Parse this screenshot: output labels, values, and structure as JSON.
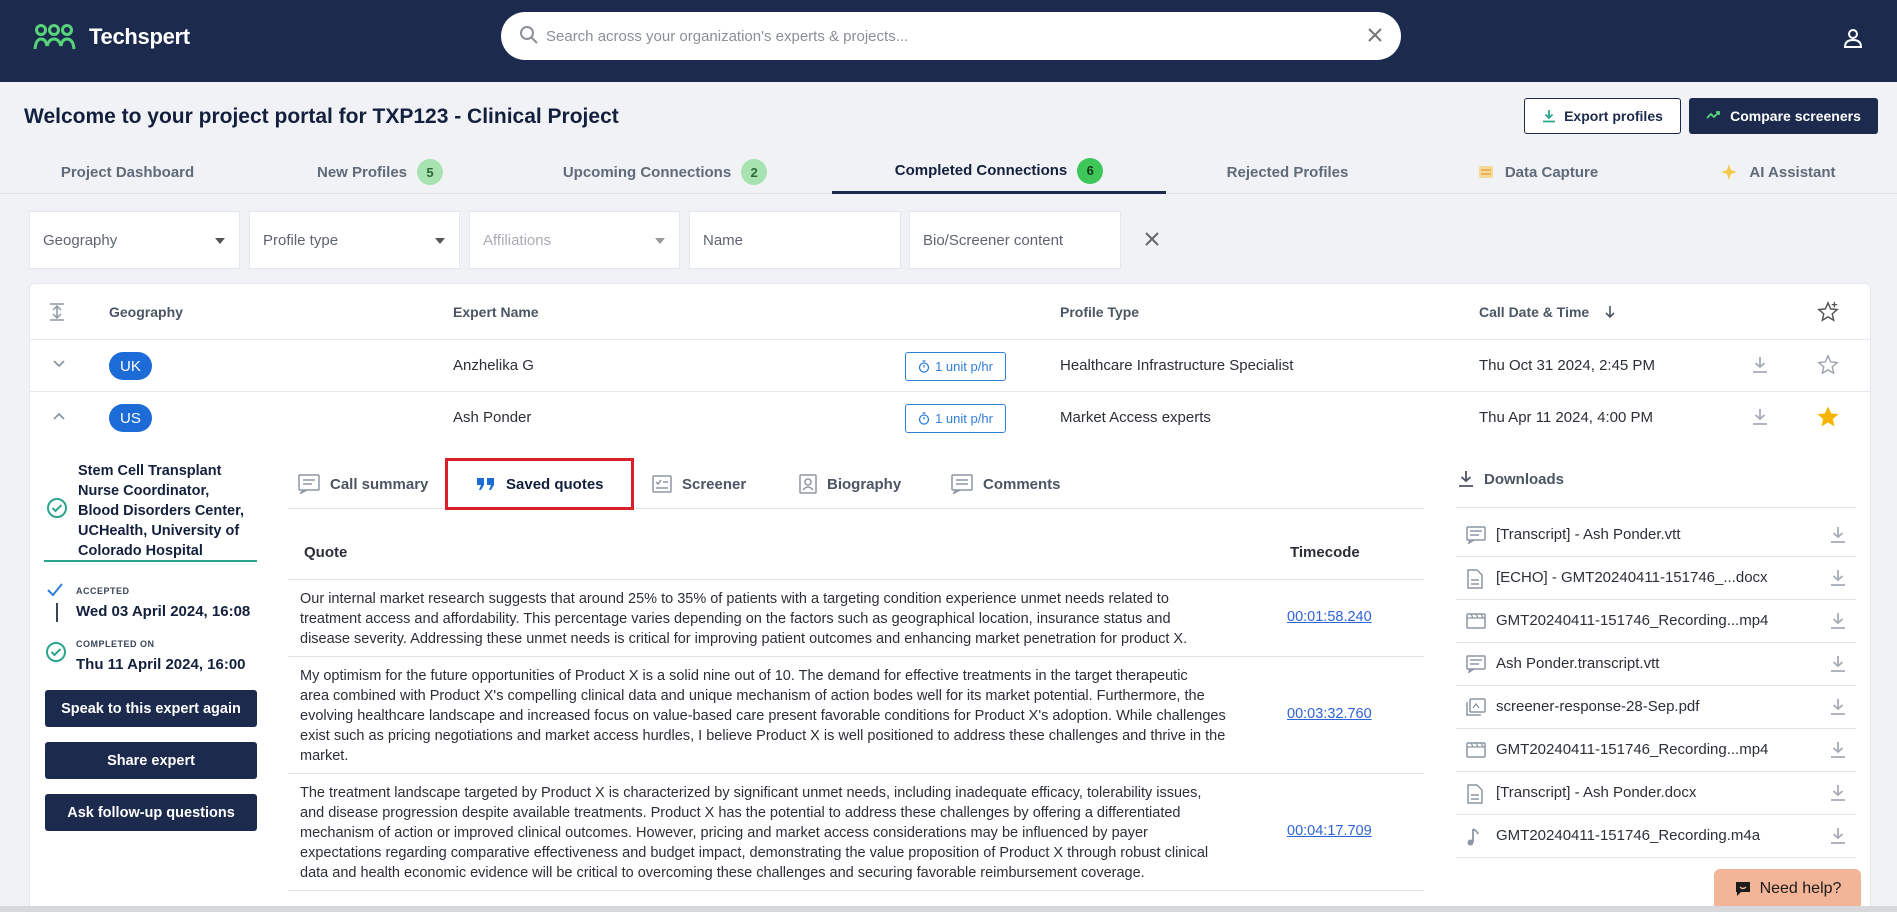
{
  "brand": {
    "name": "Techspert"
  },
  "search": {
    "placeholder": "Search across your organization's experts & projects..."
  },
  "page": {
    "title": "Welcome to your project portal for TXP123 - Clinical Project"
  },
  "actions": {
    "export_label": "Export profiles",
    "compare_label": "Compare screeners"
  },
  "tabs": [
    {
      "label": "Project Dashboard"
    },
    {
      "label": "New Profiles",
      "count": "5"
    },
    {
      "label": "Upcoming Connections",
      "count": "2"
    },
    {
      "label": "Completed Connections",
      "count": "6"
    },
    {
      "label": "Rejected Profiles"
    },
    {
      "label": "Data Capture"
    },
    {
      "label": "AI Assistant"
    }
  ],
  "filters": {
    "geography": "Geography",
    "profile_type": "Profile type",
    "affiliations": "Affiliations",
    "name": "Name",
    "bio": "Bio/Screener content"
  },
  "table": {
    "headers": {
      "geography": "Geography",
      "expert_name": "Expert Name",
      "profile_type": "Profile Type",
      "call_date": "Call Date & Time"
    },
    "rows": [
      {
        "geo": "UK",
        "name": "Anzhelika G",
        "unit": "1 unit p/hr",
        "profile_type": "Healthcare Infrastructure Specialist",
        "date": "Thu Oct 31 2024, 2:45 PM",
        "starred": false
      },
      {
        "geo": "US",
        "name": "Ash Ponder",
        "unit": "1 unit p/hr",
        "profile_type": "Market Access experts",
        "date": "Thu Apr 11 2024, 4:00 PM",
        "starred": true
      }
    ]
  },
  "expanded": {
    "title_lines": [
      "Stem Cell Transplant",
      "Nurse Coordinator,",
      "Blood Disorders Center,",
      "UCHealth, University of",
      "Colorado Hospital"
    ],
    "accepted_label": "ACCEPTED",
    "accepted_value": "Wed 03 April 2024, 16:08",
    "completed_label": "COMPLETED ON",
    "completed_value": "Thu 11 April 2024, 16:00",
    "buttons": {
      "speak": "Speak to this expert again",
      "share": "Share expert",
      "followup": "Ask follow-up questions"
    }
  },
  "subtabs": [
    "Call summary",
    "Saved quotes",
    "Screener",
    "Biography",
    "Comments"
  ],
  "quotes": {
    "headers": {
      "quote": "Quote",
      "timecode": "Timecode"
    },
    "rows": [
      {
        "lines": [
          "Our internal market research suggests that around 25% to 35% of patients with a targeting condition experience unmet needs related to",
          "treatment access and affordability. This percentage varies depending on the factors such as geographical location, insurance status and",
          "disease severity. Addressing these unmet needs is critical for improving patient outcomes and enhancing market penetration for product X."
        ],
        "timecode": "00:01:58.240"
      },
      {
        "lines": [
          "My optimism for the future opportunities of Product X is a solid nine out of 10. The demand for effective treatments in the target therapeutic",
          "area combined with Product X's compelling clinical data and unique mechanism of action bodes well for its market potential. Furthermore, the",
          "evolving healthcare landscape and increased focus on value-based care present favorable conditions for Product X's adoption. While challenges",
          "exist such as pricing negotiations and market access hurdles, I believe Product X is well positioned to address these challenges and thrive in the",
          "market."
        ],
        "timecode": "00:03:32.760"
      },
      {
        "lines": [
          "The treatment landscape targeted by Product X is characterized by significant unmet needs, including inadequate efficacy, tolerability issues,",
          "and disease progression despite available treatments. Product X has the potential to address these challenges by offering a differentiated",
          "mechanism of action or improved clinical outcomes. However, pricing and market access considerations may be influenced by payer",
          "expectations regarding comparative effectiveness and budget impact, demonstrating the value proposition of Product X through robust clinical",
          "data and health economic evidence will be critical to overcoming these challenges and securing favorable reimbursement coverage."
        ],
        "timecode": "00:04:17.709"
      }
    ]
  },
  "downloads": {
    "title": "Downloads",
    "files": [
      {
        "name": "[Transcript] - Ash Ponder.vtt",
        "icon": "transcript-icon"
      },
      {
        "name": "[ECHO] - GMT20240411-151746_...docx",
        "icon": "document-icon"
      },
      {
        "name": "GMT20240411-151746_Recording...mp4",
        "icon": "video-icon"
      },
      {
        "name": "Ash Ponder.transcript.vtt",
        "icon": "transcript-icon"
      },
      {
        "name": "screener-response-28-Sep.pdf",
        "icon": "pdf-icon"
      },
      {
        "name": "GMT20240411-151746_Recording...mp4",
        "icon": "video-icon"
      },
      {
        "name": "[Transcript] - Ash Ponder.docx",
        "icon": "document-icon"
      },
      {
        "name": "GMT20240411-151746_Recording.m4a",
        "icon": "audio-icon"
      }
    ]
  },
  "help": {
    "label": "Need help?"
  },
  "colors": {
    "navy": "#1c2a4d",
    "accent_blue": "#1c6bd6",
    "highlight_red": "#d9202a",
    "star": "#f4b400",
    "badge_green": "#a7e3b0"
  }
}
